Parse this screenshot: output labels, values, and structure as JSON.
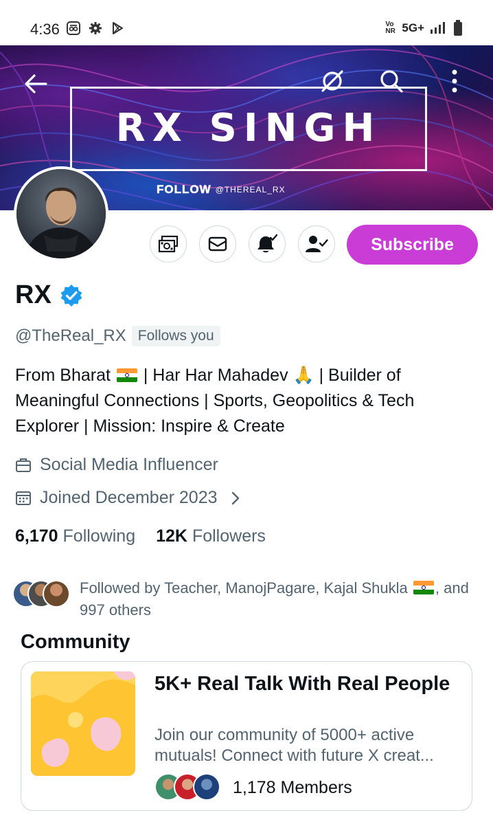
{
  "status_bar": {
    "time": "4:36",
    "network": "5G+",
    "volte": "Vo NR"
  },
  "banner": {
    "title": "RX SINGH",
    "follow_word": "FOLLOW",
    "handle": "@THEREAL_RX"
  },
  "header": {
    "back_icon": "arrow-left-icon",
    "grok_icon": "grok-icon",
    "search_icon": "search-icon",
    "more_icon": "more-vertical-icon"
  },
  "actions": {
    "tip_icon": "money-icon",
    "message_icon": "mail-icon",
    "notify_icon": "bell-check-icon",
    "follow_icon": "person-check-icon",
    "subscribe_label": "Subscribe",
    "subscribe_color": "#c93dd6"
  },
  "profile": {
    "name": "RX",
    "verified": true,
    "handle": "@TheReal_RX",
    "follows_you": "Follows you",
    "bio_parts": [
      "From Bharat ",
      " | Har Har Mahadev 🙏 | Builder of Meaningful Connections | Sports, Geopolitics & Tech Explorer | Mission: Inspire & Create"
    ],
    "category": "Social Media Influencer",
    "joined": "Joined December 2023",
    "following_count": "6,170",
    "following_label": "Following",
    "followers_count": "12K",
    "followers_label": "Followers"
  },
  "followed_by": {
    "prefix": "Followed by Teacher, ManojPagare, Kajal Shukla",
    "suffix": ", and 997 others"
  },
  "community": {
    "heading": "Community",
    "title": "5K+ Real Talk With Real People",
    "desc_line1": "Join our community of 5000+ active",
    "desc_line2": "mutuals! Connect with future X creat...",
    "members": "1,178 Members"
  },
  "colors": {
    "accent": "#c93dd6",
    "verified": "#1d9bf0",
    "secondary_text": "#536471"
  }
}
